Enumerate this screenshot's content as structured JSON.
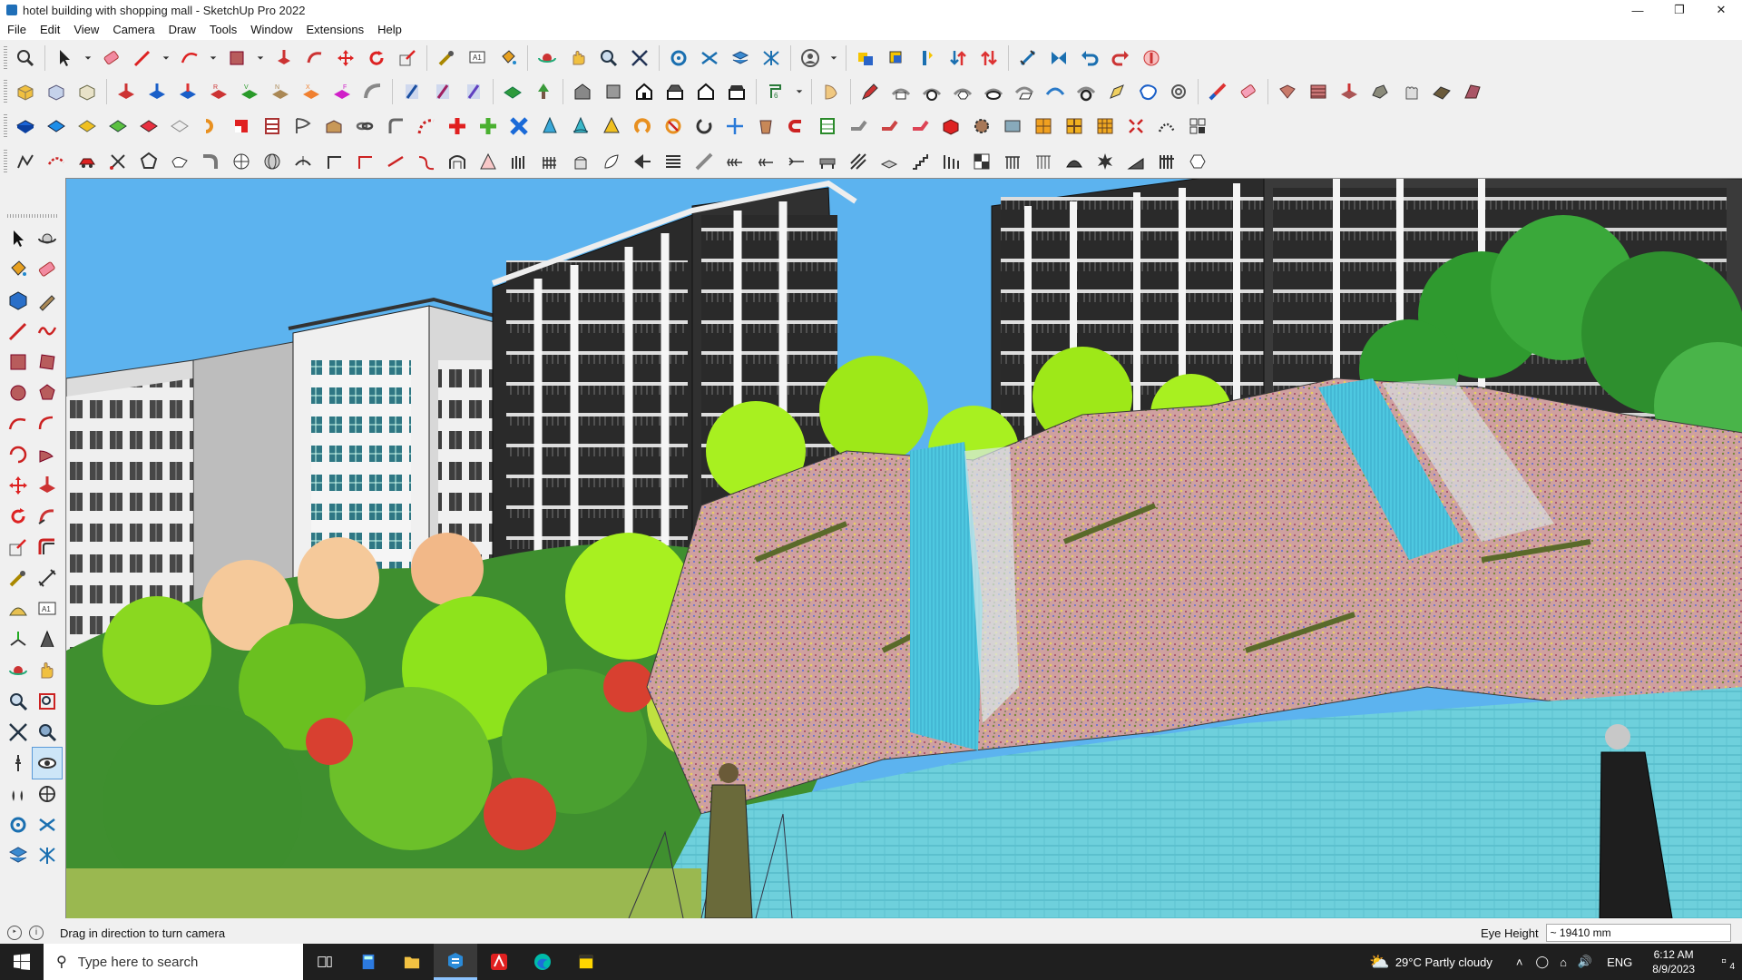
{
  "window": {
    "title": "hotel building with shopping mall - SketchUp Pro 2022",
    "controls": [
      "minimize-icon",
      "restore-icon",
      "close-icon"
    ]
  },
  "menu": [
    "File",
    "Edit",
    "View",
    "Camera",
    "Draw",
    "Tools",
    "Window",
    "Extensions",
    "Help"
  ],
  "status": {
    "message": "Drag in direction to turn camera",
    "vcb_label": "Eye Height",
    "vcb_value": "~ 19410 mm"
  },
  "taskbar": {
    "search_placeholder": "Type here to search",
    "weather": "29°C  Partly cloudy",
    "language": "ENG",
    "time": "6:12 AM",
    "date": "8/9/2023",
    "notifications": "4",
    "apps": [
      "task-view-icon",
      "calculator-icon",
      "file-explorer-icon",
      "sketchup-icon",
      "acrobat-icon",
      "edge-icon",
      "sticky-notes-icon"
    ]
  },
  "colors": {
    "accent": "#1f6fb8",
    "sky": "#5fb4f0",
    "water": "#5ad0e6",
    "foliage": "#8fe31a",
    "taskbar": "#1f1f1f"
  }
}
